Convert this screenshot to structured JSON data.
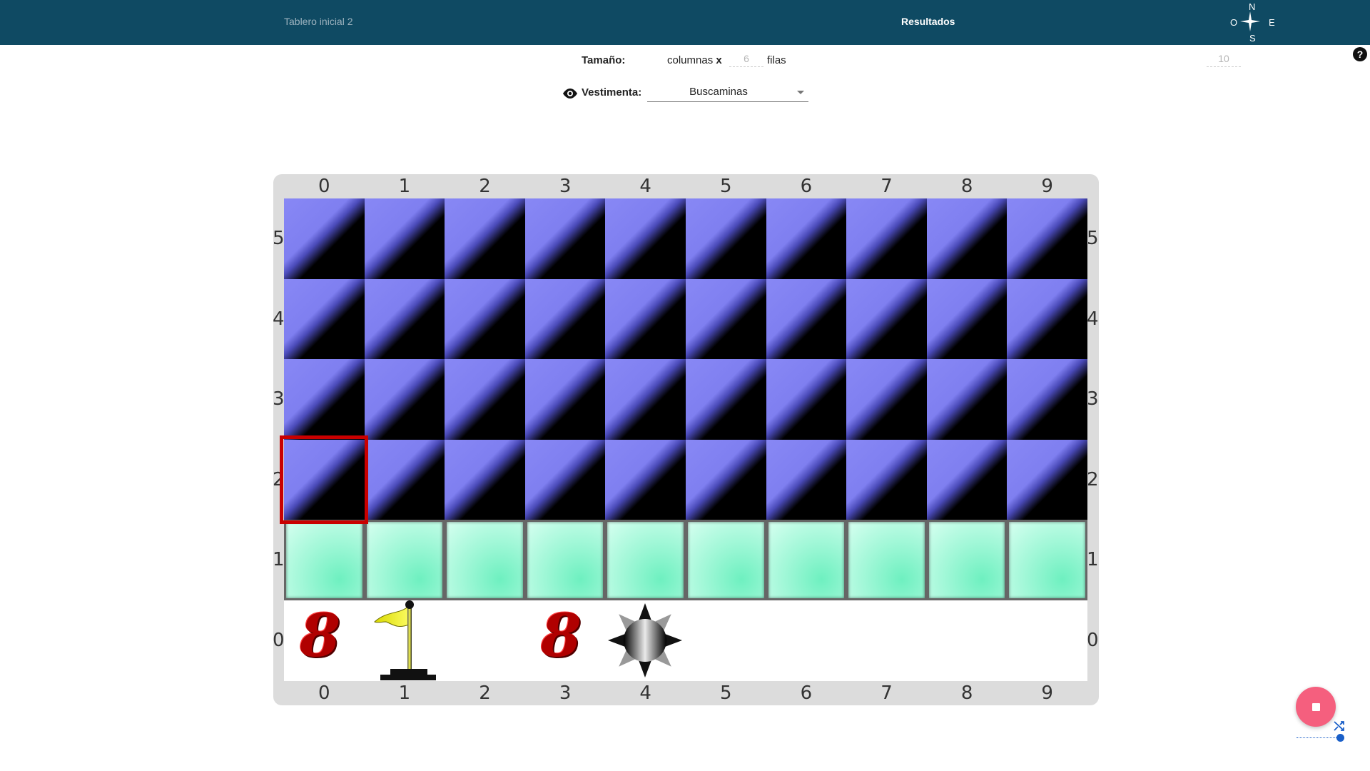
{
  "header": {
    "initial_board_tab": "Tablero inicial 2",
    "results_tab": "Resultados",
    "compass": {
      "n": "N",
      "s": "S",
      "e": "E",
      "o": "O"
    }
  },
  "help": {
    "label": "?"
  },
  "size": {
    "label": "Tamaño:",
    "columns_value": "10",
    "columns_text": "columnas",
    "times": "x",
    "rows_value": "6",
    "rows_text": "filas"
  },
  "vestimenta": {
    "label": "Vestimenta:",
    "selected": "Buscaminas"
  },
  "board": {
    "columns": [
      "0",
      "1",
      "2",
      "3",
      "4",
      "5",
      "6",
      "7",
      "8",
      "9"
    ],
    "rows": [
      "5",
      "4",
      "3",
      "2",
      "1",
      "0"
    ],
    "current_cell": {
      "column": 0,
      "row": 2
    },
    "row_states": {
      "5": "hidden",
      "4": "hidden",
      "3": "hidden",
      "2": "hidden",
      "1": "revealed",
      "0": "open"
    },
    "row0_contents": [
      {
        "column": 0,
        "type": "number",
        "text": "8"
      },
      {
        "column": 1,
        "type": "flag"
      },
      {
        "column": 3,
        "type": "number",
        "text": "8"
      },
      {
        "column": 4,
        "type": "mine"
      }
    ]
  },
  "controls": {
    "stop_color": "#f55f7e",
    "slider_color": "#1a5fc8"
  }
}
